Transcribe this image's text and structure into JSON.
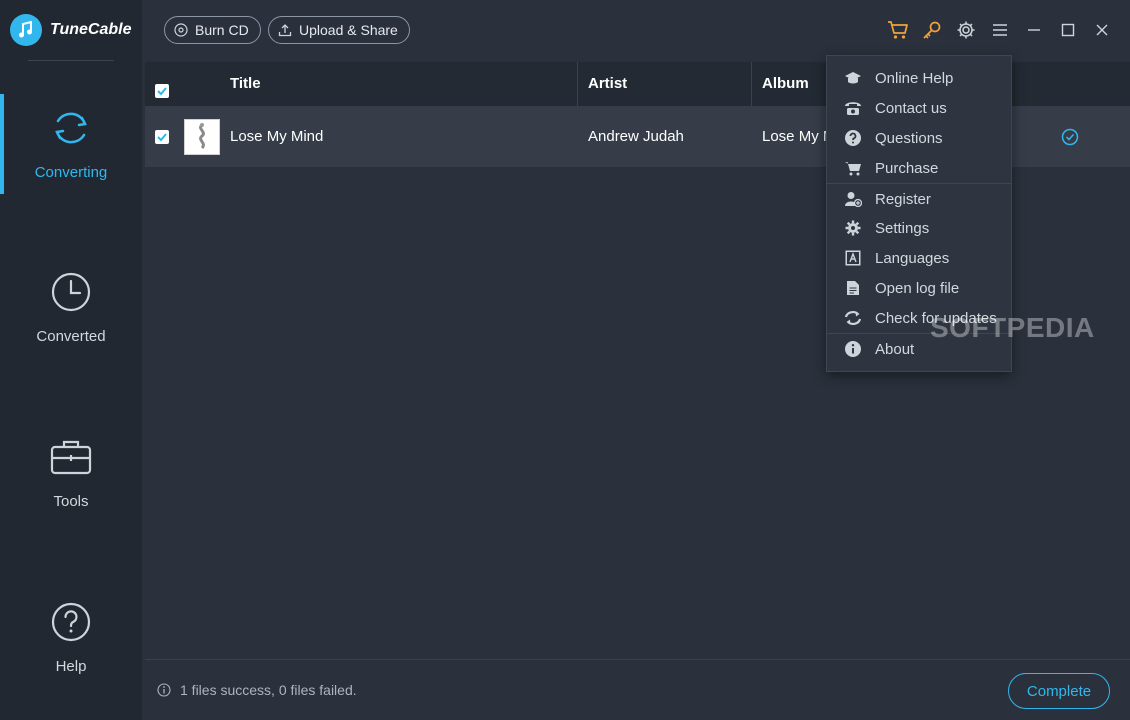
{
  "app": {
    "name": "TuneCable"
  },
  "colors": {
    "accent": "#31b7ee",
    "cart": "#f2a33a",
    "key": "#f2a33a"
  },
  "sidebar": {
    "items": [
      {
        "label": "Converting",
        "icon": "refresh-icon",
        "active": true
      },
      {
        "label": "Converted",
        "icon": "clock-icon",
        "active": false
      },
      {
        "label": "Tools",
        "icon": "toolbox-icon",
        "active": false
      },
      {
        "label": "Help",
        "icon": "question-icon",
        "active": false
      }
    ]
  },
  "toolbar": {
    "burn_cd": "Burn CD",
    "upload_share": "Upload & Share"
  },
  "table": {
    "columns": [
      "Title",
      "Artist",
      "Album"
    ],
    "rows": [
      {
        "title": "Lose My Mind",
        "artist": "Andrew Judah",
        "album": "Lose My M",
        "selected": true,
        "status": "done"
      }
    ]
  },
  "menu": {
    "items": [
      {
        "label": "Online Help",
        "icon": "graduation-cap-icon"
      },
      {
        "label": "Contact us",
        "icon": "phone-icon"
      },
      {
        "label": "Questions",
        "icon": "question-circle-icon"
      },
      {
        "label": "Purchase",
        "icon": "cart-icon"
      },
      {
        "label": "Register",
        "icon": "user-add-icon"
      },
      {
        "label": "Settings",
        "icon": "gear-icon"
      },
      {
        "label": "Languages",
        "icon": "language-icon"
      },
      {
        "label": "Open log file",
        "icon": "file-icon"
      },
      {
        "label": "Check for updates",
        "icon": "sync-icon"
      },
      {
        "label": "About",
        "icon": "info-icon"
      }
    ]
  },
  "footer": {
    "status_text": "1 files success, 0 files failed.",
    "complete_label": "Complete"
  },
  "watermark": {
    "text": "SOFTPEDIA"
  }
}
